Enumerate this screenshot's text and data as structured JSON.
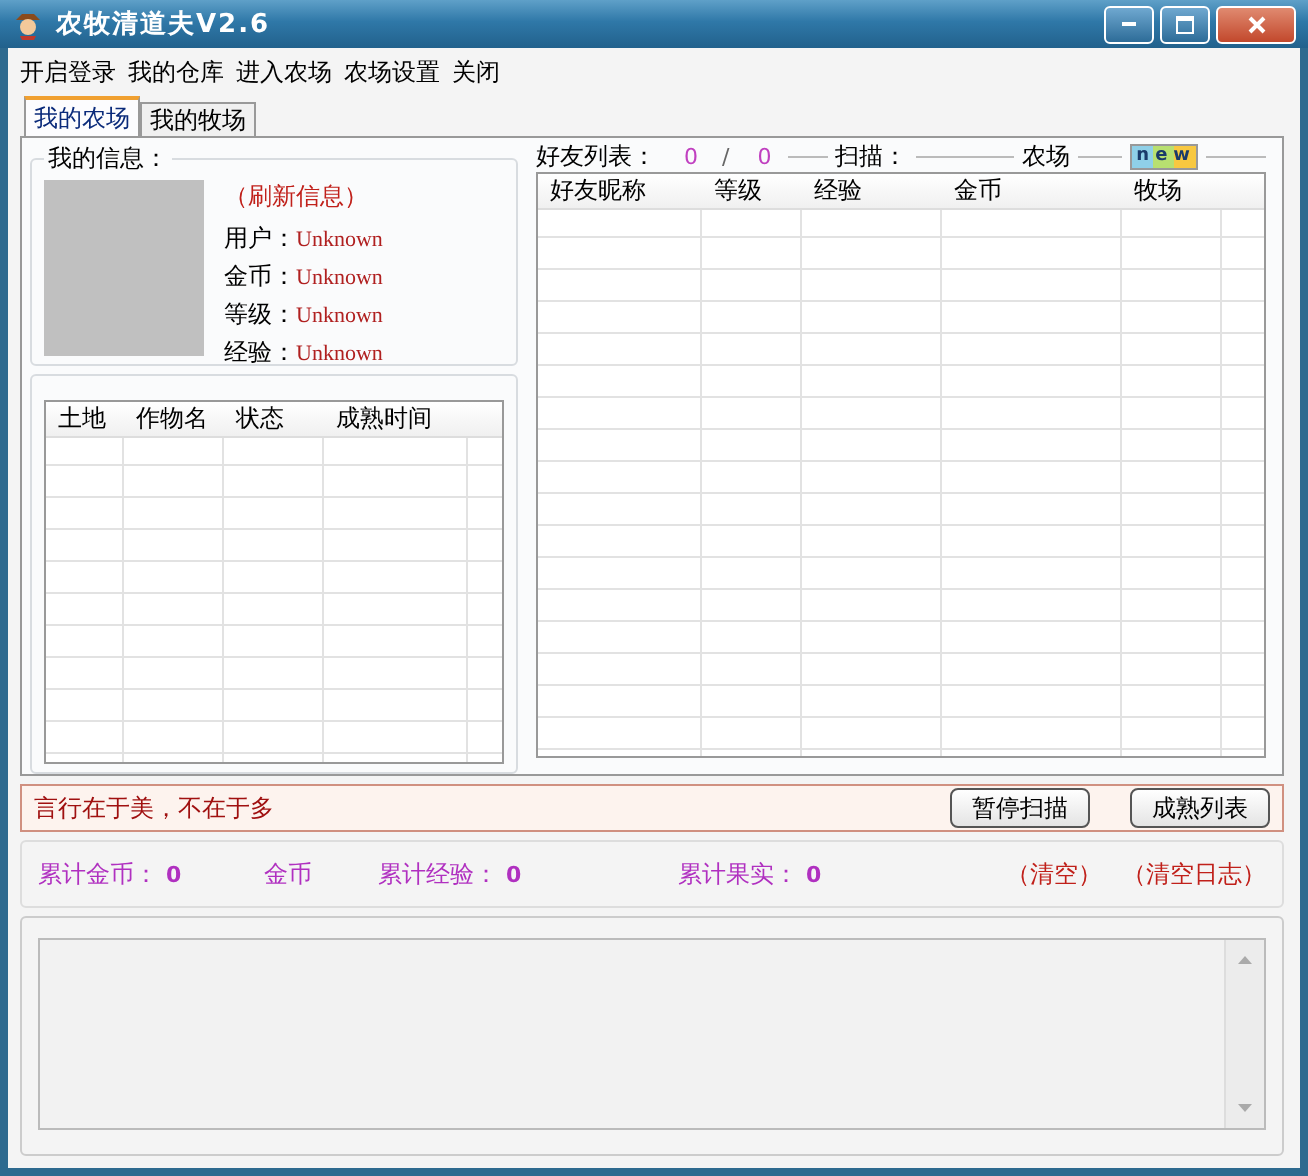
{
  "window": {
    "title": "农牧清道夫V2.6"
  },
  "menu": [
    "开启登录",
    "我的仓库",
    "进入农场",
    "农场设置",
    "关闭"
  ],
  "tabs": [
    {
      "label": "我的农场",
      "selected": true
    },
    {
      "label": "我的牧场",
      "selected": false
    }
  ],
  "my_info": {
    "title": "我的信息：",
    "refresh": "（刷新信息）",
    "fields": [
      {
        "label": "用户：",
        "value": "Unknown"
      },
      {
        "label": "金币：",
        "value": "Unknown"
      },
      {
        "label": "等级：",
        "value": "Unknown"
      },
      {
        "label": "经验：",
        "value": "Unknown"
      }
    ]
  },
  "crops_table": {
    "columns": [
      "土地",
      "作物名",
      "状态",
      "成熟时间"
    ]
  },
  "friends": {
    "title": "好友列表：",
    "count": "0",
    "separator": "/",
    "total": "0",
    "scan_label": "扫描：",
    "farm_label": "农场",
    "badge": "new",
    "table": {
      "columns": [
        "好友昵称",
        "等级",
        "经验",
        "金币",
        "牧场"
      ]
    }
  },
  "status": {
    "message": "言行在于美，不在于多",
    "buttons": [
      "暂停扫描",
      "成熟列表"
    ]
  },
  "stats": [
    {
      "label": "累计金币：",
      "value": "0"
    },
    {
      "label": "金币"
    },
    {
      "label": "累计经验：",
      "value": "0"
    },
    {
      "label": "累计果实：",
      "value": "0"
    }
  ],
  "links": [
    "（清空）",
    "（清空日志）"
  ]
}
